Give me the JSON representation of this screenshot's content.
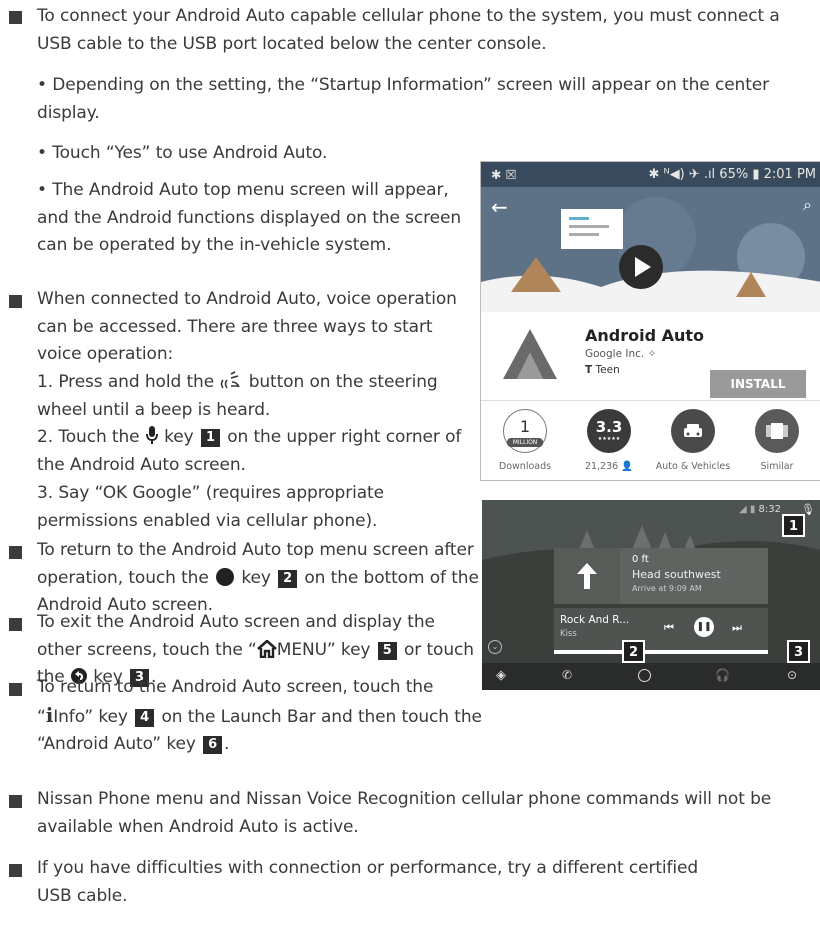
{
  "paragraphs": {
    "p1": "To connect your Android Auto capable cellular phone to the system, you must connect a USB cable to the USB port located below the center console.",
    "p1_sub1": "• Depending on the setting, the “Startup Information” screen will appear on the center display.",
    "p1_sub2": "• Touch “Yes” to use Android Auto.",
    "p1_sub3": "• The Android Auto top menu screen will appear, and the Android functions displayed on the screen can be operated by the in-vehicle system.",
    "p2": "When connected to Android Auto, voice operation can be accessed. There are three ways to start voice operation:",
    "p2_i1a": "1. Press and hold the",
    "p2_i1b": "button on the steering wheel until a beep is heard.",
    "p2_i2a": "2. Touch the",
    "p2_i2b": "key",
    "p2_i2c": "on the upper right corner of the Android Auto screen.",
    "p2_i3": "3. Say “OK Google” (requires appropriate permissions enabled via cellular phone).",
    "p3a": "To return to the Android Auto top menu screen after operation, touch the",
    "p3b": "key",
    "p3c": "on the bottom of the Android Auto screen.",
    "p4a": "To exit the Android Auto screen and display the other screens, touch the “",
    "p4b": "MENU” key",
    "p4c": "or touch the",
    "p4d": "key",
    "p5a": "To return to the Android Auto screen, touch the “",
    "p5b": "Info” key",
    "p5c": "on the Launch Bar and then touch the “Android Auto” key",
    "p6": "Nissan Phone menu and Nissan Voice Recognition cellular phone commands will not be available when Android Auto is active.",
    "p7": "If you have difficulties with connection or performance, try a different certified USB cable."
  },
  "keys": {
    "k1": "1",
    "k2": "2",
    "k3": "3",
    "k4": "4",
    "k5": "5",
    "k6": "6"
  },
  "phone": {
    "status_left": "✱ ☒",
    "status_right": "✱ ᴺ◀) ✈ .ıl 65% ▮ 2:01 PM",
    "app_name": "Android Auto",
    "developer": "Google Inc.",
    "rating_label": "Teen",
    "install": "INSTALL",
    "downloads_value": "1",
    "downloads_unit": "MILLION",
    "downloads_label": "Downloads",
    "rating_value": "3.3",
    "rating_stars": "★★★★★",
    "reviews_label": "21,236",
    "category_label": "Auto & Vehicles",
    "similar_label": "Similar"
  },
  "car": {
    "status_time": "8:32",
    "distance": "0 ft",
    "direction": "Head southwest",
    "arrive": "Arrive at 9:09 AM",
    "song": "Rock And R...",
    "artist": "Kiss"
  },
  "colors": {
    "bullet": "#3c3c3c",
    "key_bg": "#2b2b2b",
    "play_store_green": "#6ba05a",
    "install_button": "#9a9a9a"
  }
}
